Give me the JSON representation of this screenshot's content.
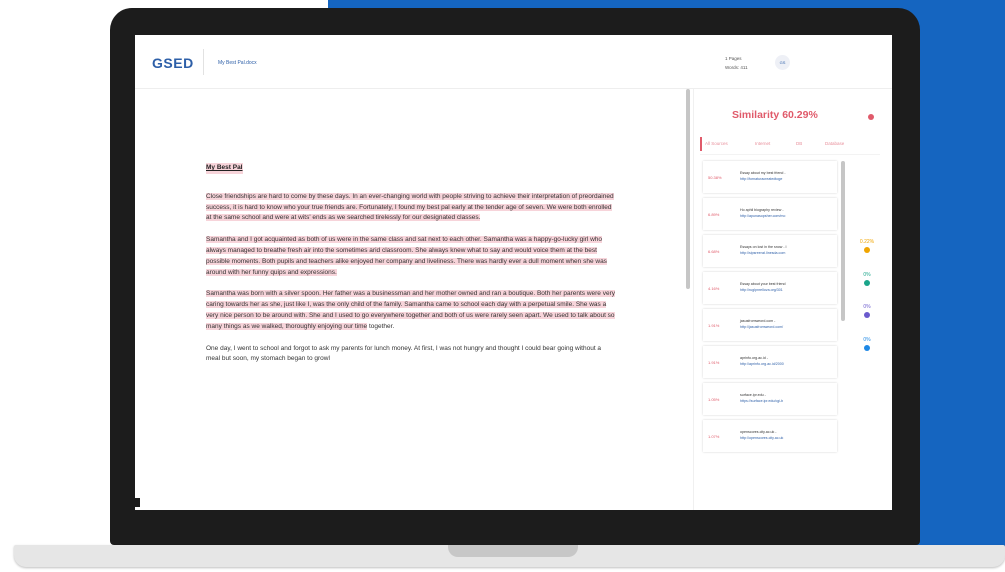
{
  "app": {
    "logo": "GSED",
    "doc_title": "My Best Pal.docx",
    "meta_pages": "1 Pages",
    "meta_words": "Words: 411",
    "avatar": "GS"
  },
  "document": {
    "heading": "My Best Pal",
    "p1": "Close friendships are hard to come by these days. In an ever-changing world with people striving to achieve their interpretation of preordained success, it is hard to know who your true friends are. Fortunately, I found my best pal early at the tender age of seven. We were both enrolled at the same school and were at wits' ends as we searched tirelessly for our designated classes.",
    "p2": "Samantha and I got acquainted as both of us were in the same class and sat next to each other. Samantha was a happy-go-lucky girl who always managed to breathe fresh air into the sometimes arid classroom. She always knew what to say and would voice them at the best possible moments. Both pupils and teachers alike enjoyed her company and liveliness. There was hardly ever a dull moment when she was around with her funny quips and expressions.",
    "p3_highlighted": "Samantha was born with a silver spoon. Her father was a businessman and her mother owned and ran a boutique. Both her parents were very caring towards her as she, just like I, was the only child of the family. Samantha came to school each day with a perpetual smile. She was a very nice person to be around with. She and I used to go everywhere together and both of us were rarely seen apart. We used to talk about so many things as we walked, thoroughly enjoying our time",
    "p3_plain": " together.",
    "p4": "One day, I went to school and forgot to ask my parents for lunch money. At first, I was not hungry and thought I could bear going without a meal but soon, my stomach began to growl"
  },
  "panel": {
    "similarity": "Similarity 60.29%",
    "tabs": [
      "All Sources",
      "Internet",
      "DB",
      "Database"
    ],
    "sources": [
      {
        "pct": "50.38%",
        "title": "Essay about my best friend -",
        "url": "http://fornaturacreatedtoge"
      },
      {
        "pct": "6.89%",
        "title": "Ho aphil biography review -",
        "url": "http://apunasopsher.com/mo"
      },
      {
        "pct": "6.68%",
        "title": "Essays on lost in the snow - I",
        "url": "http://sipsreenzl.linesda.com"
      },
      {
        "pct": "4.16%",
        "title": "Essay about your best friend",
        "url": "http://ruglpnrellova.org/301"
      },
      {
        "pct": "1.91%",
        "title": "jasusfromweord.com -",
        "url": "http://jasusfromweord.com/"
      },
      {
        "pct": "1.91%",
        "title": "aprinfo.org.ac.id -",
        "url": "http://aprinfo.org.ac.id/2000"
      },
      {
        "pct": "1.05%",
        "title": "surface.ipr.edu -",
        "url": "https://surface.ipr.edu/cgi-b"
      },
      {
        "pct": "1.07%",
        "title": "openscores.city.ac.uk -",
        "url": "http://openscores.city.ac.uk"
      }
    ],
    "categories": [
      {
        "pct": "0.22%",
        "color": "#f0a500"
      },
      {
        "pct": "0%",
        "color": "#1aa58a"
      },
      {
        "pct": "0%",
        "color": "#6a5acd"
      },
      {
        "pct": "0%",
        "color": "#1e88e5"
      }
    ],
    "accent_color": "#e05a6a"
  }
}
